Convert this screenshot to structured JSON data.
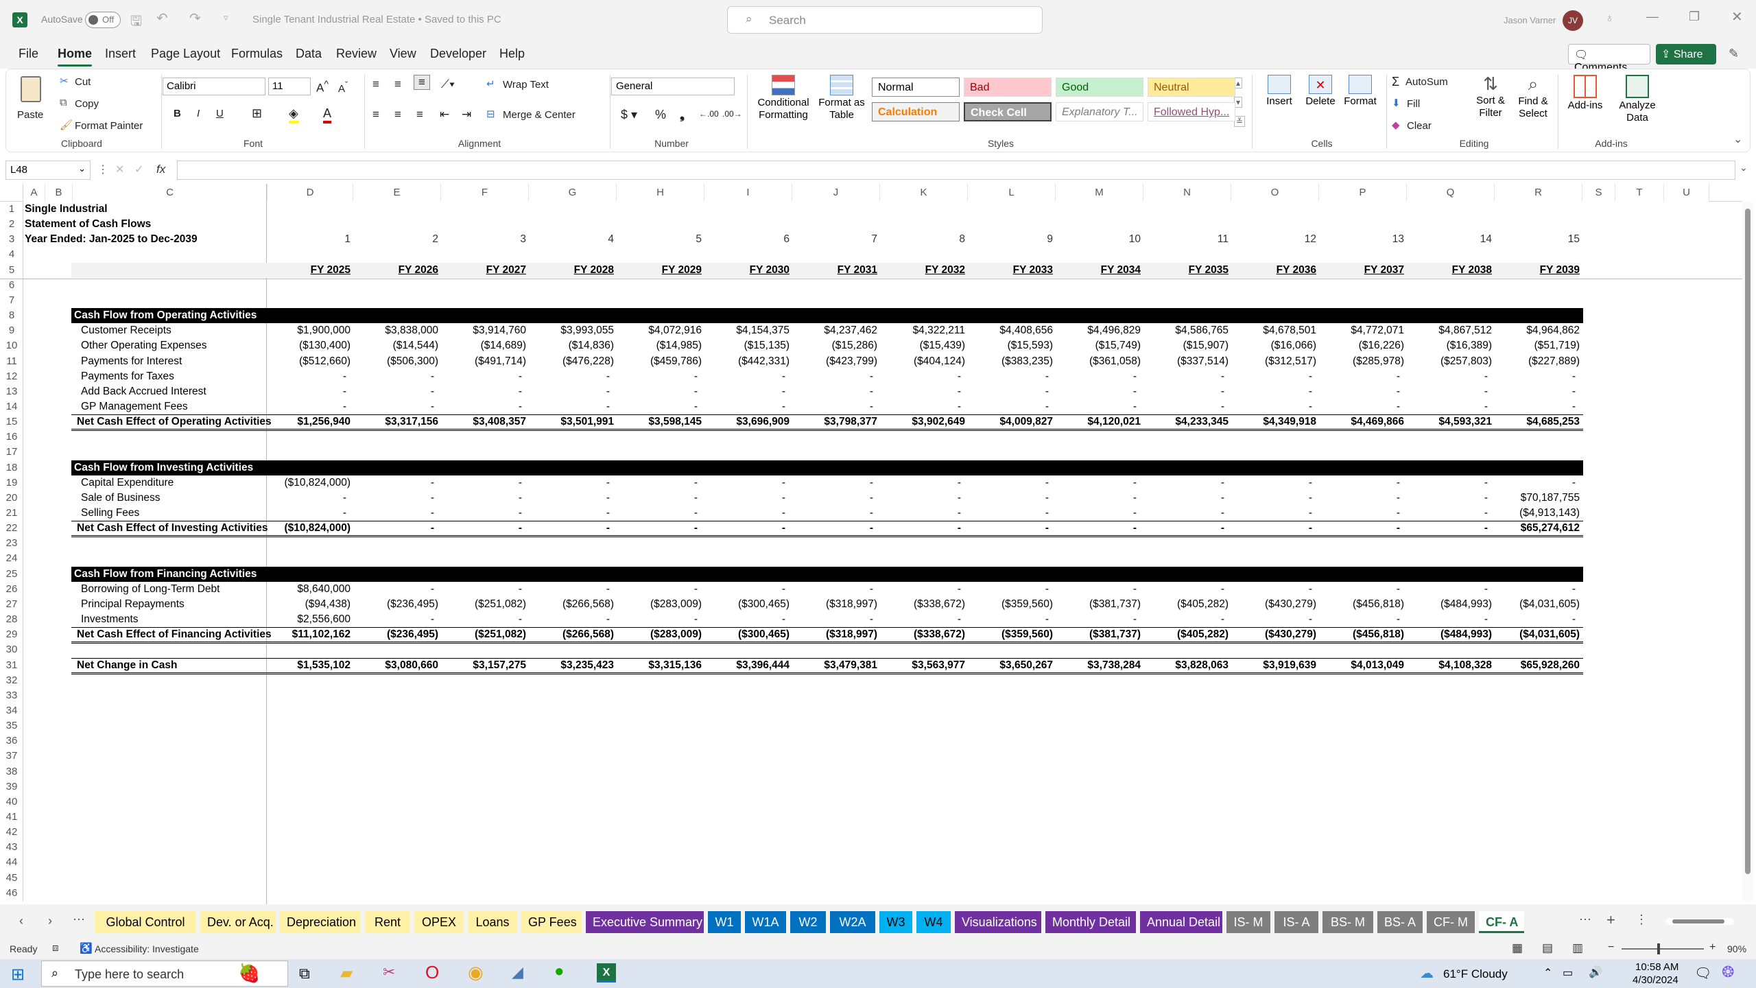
{
  "app": {
    "autosave": "AutoSave",
    "autosave_state": "Off",
    "doc_title": "Single Tenant Industrial Real Estate • Saved to this PC",
    "search_placeholder": "Search",
    "user": "Jason Varner",
    "user_initials": "JV"
  },
  "menu": {
    "tabs": [
      "File",
      "Home",
      "Insert",
      "Page Layout",
      "Formulas",
      "Data",
      "Review",
      "View",
      "Developer",
      "Help"
    ],
    "comments": "Comments",
    "share": "Share"
  },
  "ribbon": {
    "clipboard": {
      "paste": "Paste",
      "cut": "Cut",
      "copy": "Copy",
      "format_painter": "Format Painter",
      "label": "Clipboard"
    },
    "font": {
      "name": "Calibri",
      "size": "11",
      "label": "Font"
    },
    "alignment": {
      "wrap": "Wrap Text",
      "merge": "Merge & Center",
      "label": "Alignment"
    },
    "number": {
      "format": "General",
      "label": "Number"
    },
    "styles": {
      "cond": "Conditional Formatting",
      "table": "Format as Table",
      "cells": [
        {
          "text": "Normal",
          "bg": "#ffffff",
          "fg": "#000000"
        },
        {
          "text": "Bad",
          "bg": "#ffc7ce",
          "fg": "#9c0006"
        },
        {
          "text": "Good",
          "bg": "#c6efce",
          "fg": "#006100"
        },
        {
          "text": "Neutral",
          "bg": "#ffeb9c",
          "fg": "#9c5700"
        },
        {
          "text": "Calculation",
          "bg": "#f2f2f2",
          "fg": "#fa7d00"
        },
        {
          "text": "Check Cell",
          "bg": "#a5a5a5",
          "fg": "#ffffff"
        },
        {
          "text": "Explanatory T...",
          "bg": "#ffffff",
          "fg": "#7f7f7f"
        },
        {
          "text": "Followed Hyp...",
          "bg": "#ffffff",
          "fg": "#954f72"
        }
      ],
      "label": "Styles"
    },
    "cells": {
      "insert": "Insert",
      "delete": "Delete",
      "format": "Format",
      "label": "Cells"
    },
    "editing": {
      "autosum": "AutoSum",
      "fill": "Fill",
      "clear": "Clear",
      "sort": "Sort & Filter",
      "find": "Find & Select",
      "label": "Editing"
    },
    "addins": {
      "addins": "Add-ins",
      "analyze": "Analyze Data",
      "label": "Add-ins"
    }
  },
  "formula": {
    "namebox": "L48",
    "fx": "fx"
  },
  "columns": [
    "A",
    "B",
    "C",
    "D",
    "E",
    "F",
    "G",
    "H",
    "I",
    "J",
    "K",
    "L",
    "M",
    "N",
    "O",
    "P",
    "Q",
    "R",
    "S",
    "T",
    "U"
  ],
  "sheet": {
    "title1": "Single Industrial",
    "title2": "Statement of Cash Flows",
    "title3": "Year Ended: Jan-2025 to Dec-2039",
    "periods": [
      "1",
      "2",
      "3",
      "4",
      "5",
      "6",
      "7",
      "8",
      "9",
      "10",
      "11",
      "12",
      "13",
      "14",
      "15"
    ],
    "years": [
      "FY 2025",
      "FY 2026",
      "FY 2027",
      "FY 2028",
      "FY 2029",
      "FY 2030",
      "FY 2031",
      "FY 2032",
      "FY 2033",
      "FY 2034",
      "FY 2035",
      "FY 2036",
      "FY 2037",
      "FY 2038",
      "FY 2039"
    ],
    "op_header": "Cash Flow from Operating Activities",
    "op_rows": [
      {
        "label": "Customer Receipts",
        "values": [
          "$1,900,000",
          "$3,838,000",
          "$3,914,760",
          "$3,993,055",
          "$4,072,916",
          "$4,154,375",
          "$4,237,462",
          "$4,322,211",
          "$4,408,656",
          "$4,496,829",
          "$4,586,765",
          "$4,678,501",
          "$4,772,071",
          "$4,867,512",
          "$4,964,862"
        ]
      },
      {
        "label": "Other Operating Expenses",
        "values": [
          "($130,400)",
          "($14,544)",
          "($14,689)",
          "($14,836)",
          "($14,985)",
          "($15,135)",
          "($15,286)",
          "($15,439)",
          "($15,593)",
          "($15,749)",
          "($15,907)",
          "($16,066)",
          "($16,226)",
          "($16,389)",
          "($51,719)"
        ]
      },
      {
        "label": "Payments for Interest",
        "values": [
          "($512,660)",
          "($506,300)",
          "($491,714)",
          "($476,228)",
          "($459,786)",
          "($442,331)",
          "($423,799)",
          "($404,124)",
          "($383,235)",
          "($361,058)",
          "($337,514)",
          "($312,517)",
          "($285,978)",
          "($257,803)",
          "($227,889)"
        ]
      },
      {
        "label": "Payments for Taxes",
        "values": [
          "-",
          "-",
          "-",
          "-",
          "-",
          "-",
          "-",
          "-",
          "-",
          "-",
          "-",
          "-",
          "-",
          "-",
          "-"
        ]
      },
      {
        "label": "Add Back Accrued Interest",
        "values": [
          "-",
          "-",
          "-",
          "-",
          "-",
          "-",
          "-",
          "-",
          "-",
          "-",
          "-",
          "-",
          "-",
          "-",
          "-"
        ]
      },
      {
        "label": "GP Management Fees",
        "values": [
          "-",
          "-",
          "-",
          "-",
          "-",
          "-",
          "-",
          "-",
          "-",
          "-",
          "-",
          "-",
          "-",
          "-",
          "-"
        ]
      }
    ],
    "op_total": {
      "label": "Net Cash Effect of Operating Activities",
      "values": [
        "$1,256,940",
        "$3,317,156",
        "$3,408,357",
        "$3,501,991",
        "$3,598,145",
        "$3,696,909",
        "$3,798,377",
        "$3,902,649",
        "$4,009,827",
        "$4,120,021",
        "$4,233,345",
        "$4,349,918",
        "$4,469,866",
        "$4,593,321",
        "$4,685,253"
      ]
    },
    "inv_header": "Cash Flow from Investing Activities",
    "inv_rows": [
      {
        "label": "Capital Expenditure",
        "values": [
          "($10,824,000)",
          "-",
          "-",
          "-",
          "-",
          "-",
          "-",
          "-",
          "-",
          "-",
          "-",
          "-",
          "-",
          "-",
          "-"
        ]
      },
      {
        "label": "Sale of Business",
        "values": [
          "-",
          "-",
          "-",
          "-",
          "-",
          "-",
          "-",
          "-",
          "-",
          "-",
          "-",
          "-",
          "-",
          "-",
          "$70,187,755"
        ]
      },
      {
        "label": "Selling Fees",
        "values": [
          "-",
          "-",
          "-",
          "-",
          "-",
          "-",
          "-",
          "-",
          "-",
          "-",
          "-",
          "-",
          "-",
          "-",
          "($4,913,143)"
        ]
      }
    ],
    "inv_total": {
      "label": "Net Cash Effect of Investing Activities",
      "values": [
        "($10,824,000)",
        "-",
        "-",
        "-",
        "-",
        "-",
        "-",
        "-",
        "-",
        "-",
        "-",
        "-",
        "-",
        "-",
        "$65,274,612"
      ]
    },
    "fin_header": "Cash Flow from Financing Activities",
    "fin_rows": [
      {
        "label": "Borrowing of Long-Term Debt",
        "values": [
          "$8,640,000",
          "-",
          "-",
          "-",
          "-",
          "-",
          "-",
          "-",
          "-",
          "-",
          "-",
          "-",
          "-",
          "-",
          "-"
        ]
      },
      {
        "label": "Principal Repayments",
        "values": [
          "($94,438)",
          "($236,495)",
          "($251,082)",
          "($266,568)",
          "($283,009)",
          "($300,465)",
          "($318,997)",
          "($338,672)",
          "($359,560)",
          "($381,737)",
          "($405,282)",
          "($430,279)",
          "($456,818)",
          "($484,993)",
          "($4,031,605)"
        ]
      },
      {
        "label": "Investments",
        "values": [
          "$2,556,600",
          "-",
          "-",
          "-",
          "-",
          "-",
          "-",
          "-",
          "-",
          "-",
          "-",
          "-",
          "-",
          "-",
          "-"
        ]
      }
    ],
    "fin_total": {
      "label": "Net Cash Effect of Financing Activities",
      "values": [
        "$11,102,162",
        "($236,495)",
        "($251,082)",
        "($266,568)",
        "($283,009)",
        "($300,465)",
        "($318,997)",
        "($338,672)",
        "($359,560)",
        "($381,737)",
        "($405,282)",
        "($430,279)",
        "($456,818)",
        "($484,993)",
        "($4,031,605)"
      ]
    },
    "net_total": {
      "label": "Net Change in Cash",
      "values": [
        "$1,535,102",
        "$3,080,660",
        "$3,157,275",
        "$3,235,423",
        "$3,315,136",
        "$3,396,444",
        "$3,479,381",
        "$3,563,977",
        "$3,650,267",
        "$3,738,284",
        "$3,828,063",
        "$3,919,639",
        "$4,013,049",
        "$4,108,328",
        "$65,928,260"
      ]
    }
  },
  "tabs": [
    {
      "name": "Global Control",
      "bg": "#fff2a8",
      "fg": "#000000"
    },
    {
      "name": "Dev. or Acq.",
      "bg": "#fff2a8",
      "fg": "#000000"
    },
    {
      "name": "Depreciation",
      "bg": "#fff2a8",
      "fg": "#000000"
    },
    {
      "name": "Rent",
      "bg": "#fff2a8",
      "fg": "#000000"
    },
    {
      "name": "OPEX",
      "bg": "#fff2a8",
      "fg": "#000000"
    },
    {
      "name": "Loans",
      "bg": "#fff2a8",
      "fg": "#000000"
    },
    {
      "name": "GP Fees",
      "bg": "#fff2a8",
      "fg": "#000000"
    },
    {
      "name": "Executive Summary",
      "bg": "#7030a0",
      "fg": "#ffffff"
    },
    {
      "name": "W1",
      "bg": "#0070c0",
      "fg": "#ffffff"
    },
    {
      "name": "W1A",
      "bg": "#0070c0",
      "fg": "#ffffff"
    },
    {
      "name": "W2",
      "bg": "#0070c0",
      "fg": "#ffffff"
    },
    {
      "name": "W2A",
      "bg": "#0070c0",
      "fg": "#ffffff"
    },
    {
      "name": "W3",
      "bg": "#00b0f0",
      "fg": "#000000"
    },
    {
      "name": "W4",
      "bg": "#00b0f0",
      "fg": "#000000"
    },
    {
      "name": "Visualizations",
      "bg": "#7030a0",
      "fg": "#ffffff"
    },
    {
      "name": "Monthly Detail",
      "bg": "#7030a0",
      "fg": "#ffffff"
    },
    {
      "name": "Annual Detail",
      "bg": "#7030a0",
      "fg": "#ffffff"
    },
    {
      "name": "IS- M",
      "bg": "#7f7f7f",
      "fg": "#ffffff"
    },
    {
      "name": "IS- A",
      "bg": "#7f7f7f",
      "fg": "#ffffff"
    },
    {
      "name": "BS- M",
      "bg": "#7f7f7f",
      "fg": "#ffffff"
    },
    {
      "name": "BS- A",
      "bg": "#7f7f7f",
      "fg": "#ffffff"
    },
    {
      "name": "CF- M",
      "bg": "#7f7f7f",
      "fg": "#ffffff"
    },
    {
      "name": "CF- A",
      "bg": "#ffffff",
      "fg": "#1f7244"
    }
  ],
  "status": {
    "ready": "Ready",
    "accessibility": "Accessibility: Investigate",
    "zoom": "90%"
  },
  "taskbar": {
    "search": "Type here to search",
    "weather": "61°F  Cloudy",
    "time": "10:58 AM",
    "date": "4/30/2024"
  }
}
